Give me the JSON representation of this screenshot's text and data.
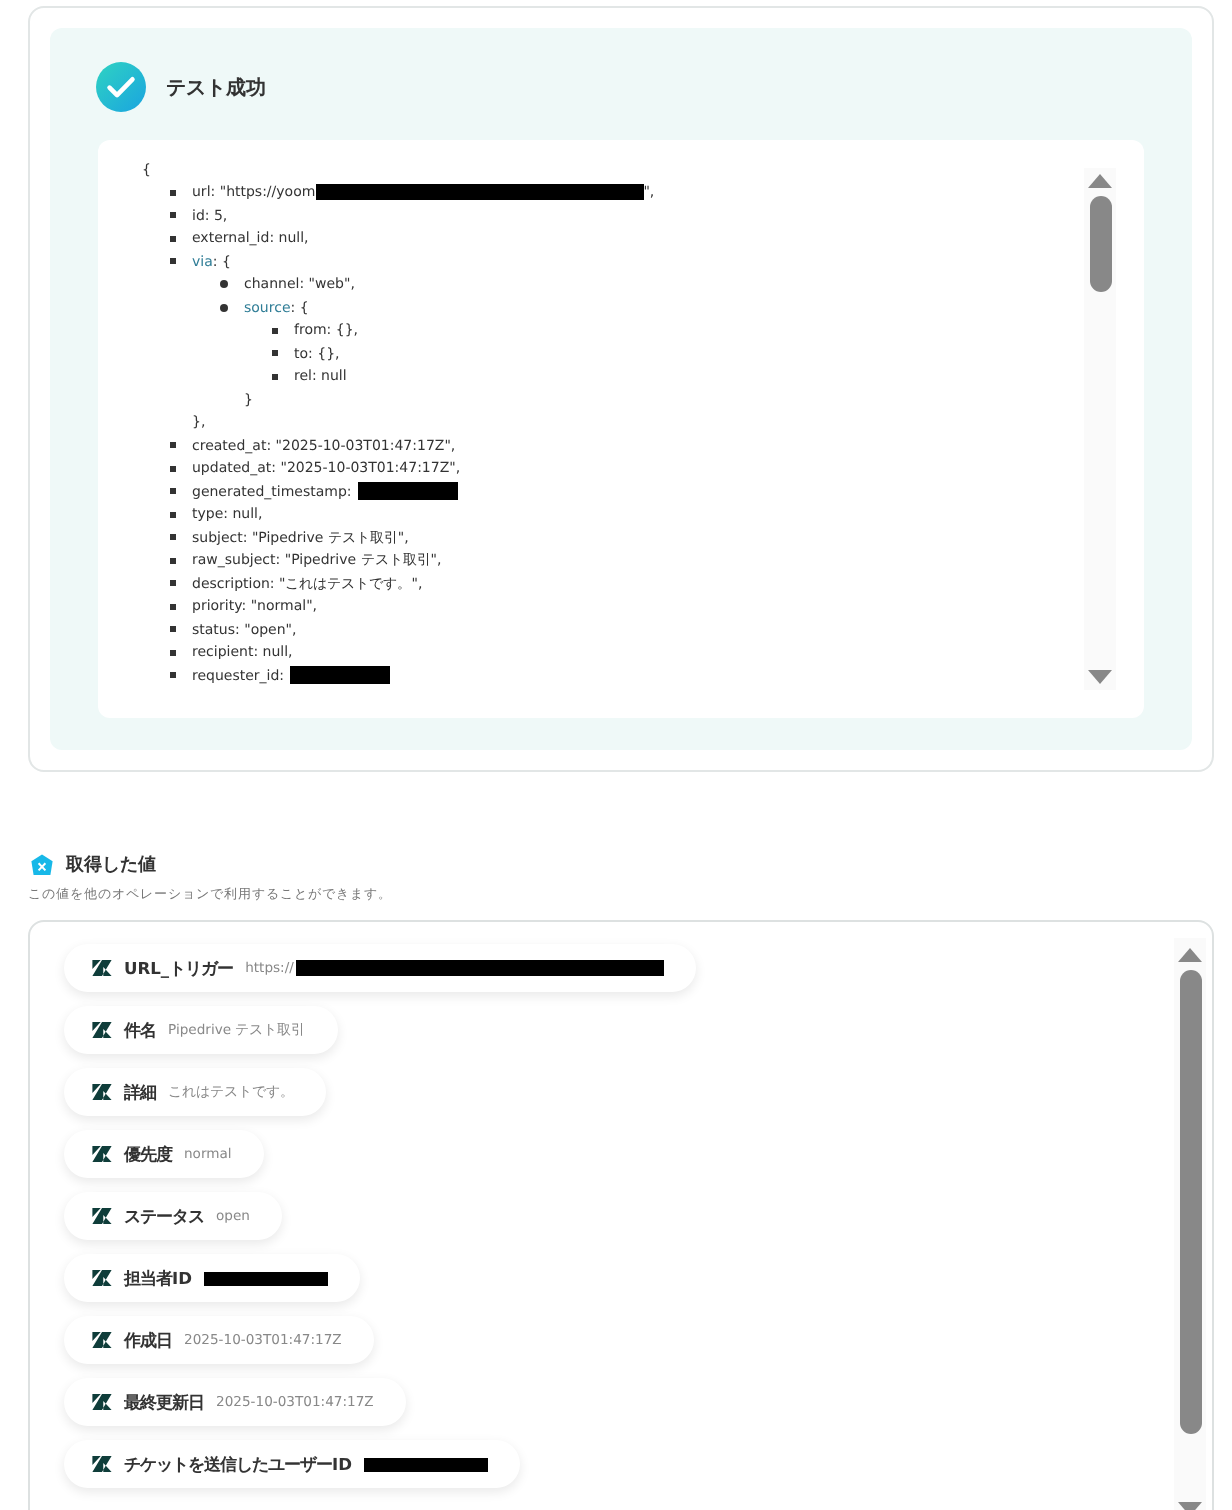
{
  "test_result": {
    "title": "テスト成功",
    "code": {
      "open": "{",
      "items": [
        {
          "key": "url",
          "rest": ": \"https://yoom",
          "redacted": true,
          "after": "\","
        },
        {
          "key": "id",
          "rest": ": 5,"
        },
        {
          "key": "external_id",
          "rest": ": null,"
        },
        {
          "key": "via",
          "rest": ": {",
          "kind": "object",
          "close": "},",
          "children": [
            {
              "key": "channel",
              "rest": ": \"web\","
            },
            {
              "key": "source",
              "rest": ": {",
              "kind": "object",
              "close": "}",
              "children": [
                {
                  "key": "from",
                  "rest": ": {},"
                },
                {
                  "key": "to",
                  "rest": ": {},"
                },
                {
                  "key": "rel",
                  "rest": ": null"
                }
              ]
            }
          ]
        },
        {
          "key": "created_at",
          "rest": ": \"2025-10-03T01:47:17Z\","
        },
        {
          "key": "updated_at",
          "rest": ": \"2025-10-03T01:47:17Z\","
        },
        {
          "key": "generated_timestamp",
          "rest": ":",
          "redacted": true
        },
        {
          "key": "type",
          "rest": ": null,"
        },
        {
          "key": "subject",
          "rest": ": \"Pipedrive テスト取引\","
        },
        {
          "key": "raw_subject",
          "rest": ": \"Pipedrive テスト取引\","
        },
        {
          "key": "description",
          "rest": ": \"これはテストです。\","
        },
        {
          "key": "priority",
          "rest": ": \"normal\","
        },
        {
          "key": "status",
          "rest": ": \"open\","
        },
        {
          "key": "recipient",
          "rest": ": null,"
        },
        {
          "key": "requester_id",
          "rest": ":",
          "redacted": true
        }
      ]
    }
  },
  "acquired_values": {
    "title": "取得した値",
    "description": "この値を他のオペレーションで利用することができます。",
    "items": [
      {
        "label": "URL_トリガー",
        "value": "https://",
        "redacted": true
      },
      {
        "label": "件名",
        "value": "Pipedrive テスト取引"
      },
      {
        "label": "詳細",
        "value": "これはテストです。"
      },
      {
        "label": "優先度",
        "value": "normal"
      },
      {
        "label": "ステータス",
        "value": "open"
      },
      {
        "label": "担当者ID",
        "redacted": true
      },
      {
        "label": "作成日",
        "value": "2025-10-03T01:47:17Z"
      },
      {
        "label": "最終更新日",
        "value": "2025-10-03T01:47:17Z"
      },
      {
        "label": "チケットを送信したユーザーID",
        "redacted": true
      }
    ]
  }
}
